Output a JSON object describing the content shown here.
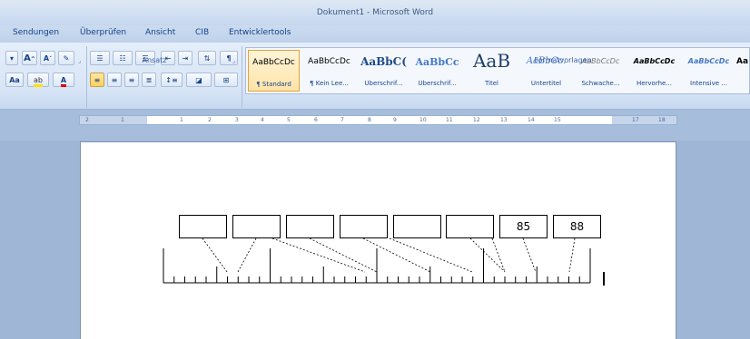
{
  "window": {
    "title": "Dokument1 - Microsoft Word"
  },
  "menu": {
    "items": [
      "Sendungen",
      "Überprüfen",
      "Ansicht",
      "CIB",
      "Entwicklertools"
    ]
  },
  "ribbon": {
    "font_group": {
      "grow_label": "A",
      "shrink_label": "A",
      "case_label": "Aa"
    },
    "paragraph_group": {
      "label": "Ansatz"
    },
    "styles_group": {
      "label": "Formatvorlagen",
      "tiles": [
        {
          "sample": "AaBbCcDc",
          "name": "¶ Standard"
        },
        {
          "sample": "AaBbCcDc",
          "name": "¶ Kein Lee..."
        },
        {
          "sample": "AaBbC(",
          "name": "Überschrif..."
        },
        {
          "sample": "AaBbCc",
          "name": "Überschrif..."
        },
        {
          "sample": "AaB",
          "name": "Titel"
        },
        {
          "sample": "AaBbCc.",
          "name": "Untertitel"
        },
        {
          "sample": "AaBbCcDc",
          "name": "Schwache..."
        },
        {
          "sample": "AaBbCcDc",
          "name": "Hervorhe..."
        },
        {
          "sample": "AaBbCcDc",
          "name": "Intensive ..."
        },
        {
          "sample": "Aa",
          "name": ""
        }
      ]
    }
  },
  "ruler": {
    "numbers": [
      "2",
      "1",
      "1",
      "2",
      "3",
      "4",
      "5",
      "6",
      "7",
      "8",
      "9",
      "10",
      "11",
      "12",
      "13",
      "14",
      "15",
      "17",
      "18"
    ]
  },
  "document": {
    "boxes": [
      "",
      "",
      "",
      "",
      "",
      "",
      "85",
      "88"
    ]
  }
}
